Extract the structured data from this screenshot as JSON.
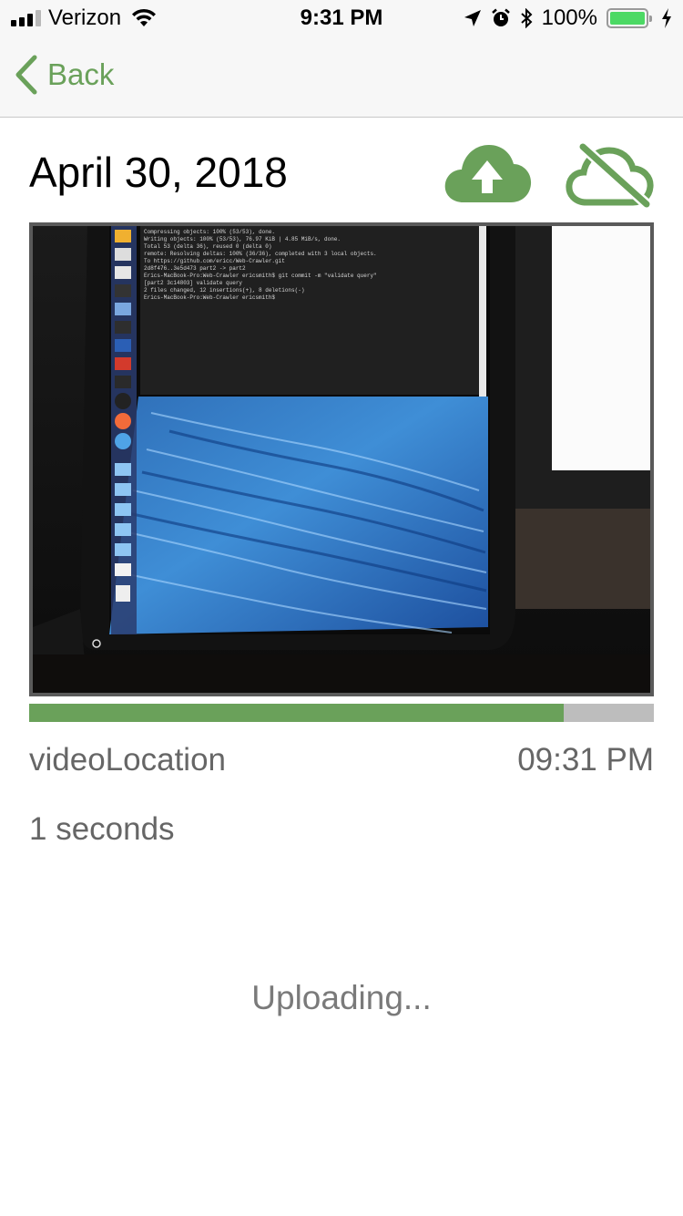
{
  "status_bar": {
    "carrier": "Verizon",
    "time": "9:31 PM",
    "battery_percent": "100%",
    "signal_bars": 3,
    "icons": [
      "wifi-icon",
      "location-arrow-icon",
      "alarm-icon",
      "bluetooth-icon",
      "battery-icon",
      "charging-bolt-icon"
    ]
  },
  "nav": {
    "back_label": "Back",
    "back_icon": "chevron-left-icon"
  },
  "recording": {
    "date": "April 30, 2018",
    "upload_icon": "cloud-upload-icon",
    "offline_icon": "cloud-off-icon",
    "thumbnail": "photo of a laptop screen showing a terminal window and an ocean wallpaper",
    "upload_progress": 0.855,
    "location": "videoLocation",
    "time": "09:31 PM",
    "duration": "1 seconds",
    "status": "Uploading..."
  },
  "colors": {
    "accent": "#6aa15a",
    "progress_track": "#bdbdbd",
    "secondary_text": "#666666"
  }
}
